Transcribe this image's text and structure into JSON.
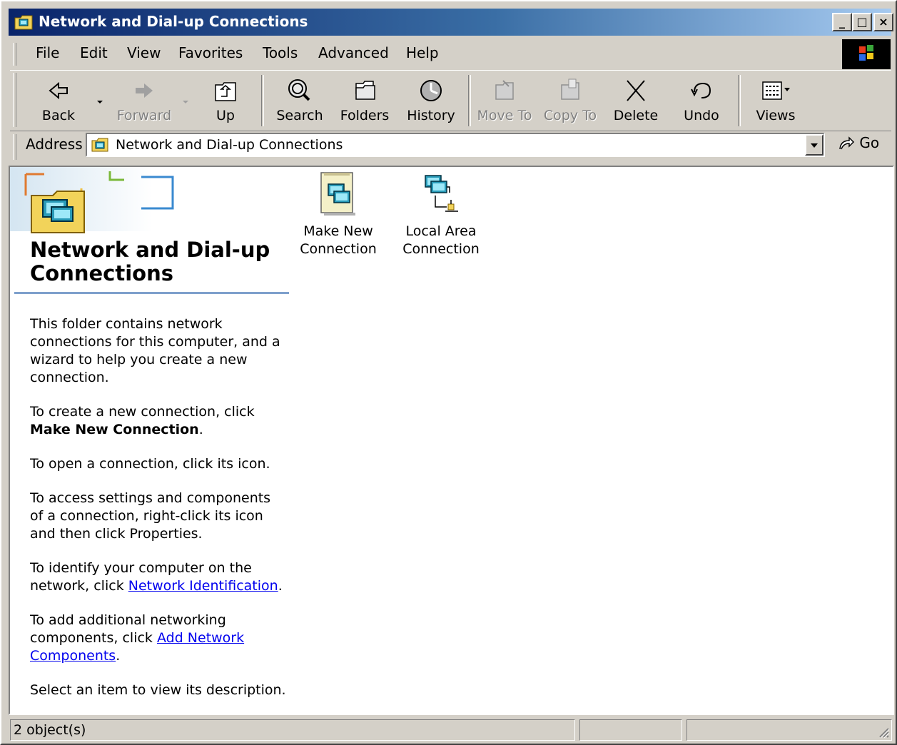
{
  "window": {
    "title": "Network and Dial-up Connections",
    "minimize_glyph": "_",
    "maximize_glyph": "□",
    "close_glyph": "×"
  },
  "menu": [
    "File",
    "Edit",
    "View",
    "Favorites",
    "Tools",
    "Advanced",
    "Help"
  ],
  "toolbar": {
    "back": "Back",
    "forward": "Forward",
    "up": "Up",
    "search": "Search",
    "folders": "Folders",
    "history": "History",
    "move_to": "Move To",
    "copy_to": "Copy To",
    "delete": "Delete",
    "undo": "Undo",
    "views": "Views"
  },
  "address": {
    "label": "Address",
    "value": "Network and Dial-up Connections",
    "go": "Go"
  },
  "panel": {
    "title": "Network and Dial-up Connections",
    "p1": "This folder contains network connections for this computer, and a wizard to help you create a new connection.",
    "p2_prefix": "To create a new connection, click",
    "p2_bold": "Make New Connection",
    "p2_suffix": ".",
    "p3": "To open a connection, click its icon.",
    "p4": "To access settings and components of a connection, right-click its icon and then click Properties.",
    "p5_prefix": "To identify your computer on the network, click",
    "p5_link": "Network Identification",
    "p5_suffix": ".",
    "p6_prefix": "To add additional networking components, click",
    "p6_link": "Add Network Components",
    "p6_suffix": ".",
    "p7": "Select an item to view its description."
  },
  "items": [
    {
      "label1": "Make New",
      "label2": "Connection"
    },
    {
      "label1": "Local Area",
      "label2": "Connection"
    }
  ],
  "status": {
    "text": "2 object(s)"
  },
  "colors": {
    "title_start": "#0a246a",
    "title_end": "#a6caf0",
    "face": "#d4d0c8",
    "link": "#0000ee"
  }
}
